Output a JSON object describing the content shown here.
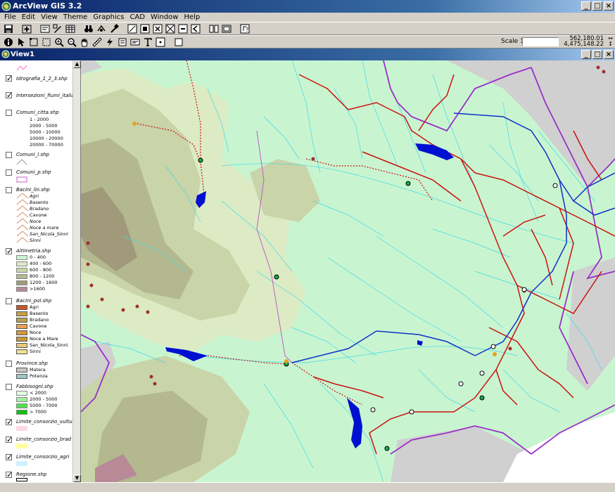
{
  "app": {
    "title": "ArcView GIS 3.2"
  },
  "window_buttons": [
    "_",
    "□",
    "×"
  ],
  "menus": [
    "File",
    "Edit",
    "View",
    "Theme",
    "Graphics",
    "CAD",
    "Window",
    "Help"
  ],
  "toolbar": {
    "scale_label": "Scale 1:",
    "scale_value": "",
    "coord_x": "562,180.01",
    "coord_y": "4,475,148.22"
  },
  "view": {
    "title": "View1"
  },
  "toc": {
    "layers": [
      {
        "name": "Idrografia_1_2_3.shp",
        "checked": true
      },
      {
        "name": "Intersezioni_fiumi_italia_.shp",
        "checked": true
      },
      {
        "name": "Comuni_citta.shp",
        "checked": false,
        "classes": [
          "1 - 2000",
          "2000 - 5000",
          "5000 - 10000",
          "10000 - 20000",
          "20000 - 70000"
        ]
      },
      {
        "name": "Comuni_l.shp",
        "checked": false
      },
      {
        "name": "Comuni_p.shp",
        "checked": false
      },
      {
        "name": "Bacini_lin.shp",
        "checked": false,
        "classes": [
          "Agri",
          "Basento",
          "Bradano",
          "Cavone",
          "Noce",
          "Noce a mare",
          "San_Nicola_Sinni",
          "Sinni"
        ]
      },
      {
        "name": "Altimetria.shp",
        "checked": true,
        "classes": [
          "0 - 400",
          "400 - 600",
          "600 - 800",
          "800 - 1200",
          "1200 - 1600",
          ">1600"
        ],
        "colors": [
          "#c8f5d0",
          "#dcebc4",
          "#c9d4a8",
          "#b3b88e",
          "#a09a7a",
          "#b88a98"
        ]
      },
      {
        "name": "Bacini_pol.shp",
        "checked": false,
        "classes": [
          "Agri",
          "Basento",
          "Bradano",
          "Cavone",
          "Noce",
          "Noce a Mare",
          "San_Nicola_Sinni",
          "Sinni"
        ],
        "colors": [
          "#c8562a",
          "#c8a040",
          "#b8a050",
          "#e8a050",
          "#d89838",
          "#c89838",
          "#e8c878",
          "#f0e090"
        ]
      },
      {
        "name": "Province.shp",
        "checked": false,
        "classes": [
          "Matera",
          "Potenza"
        ],
        "colors": [
          "#c8c8c8",
          "#a0c8c8"
        ]
      },
      {
        "name": "Fabbisogni.shp",
        "checked": false,
        "classes": [
          "< 2000",
          "2000 - 5000",
          "5000 - 7000",
          "> 7000"
        ],
        "colors": [
          "#e0ffe0",
          "#a0f0a0",
          "#50e050",
          "#10c010"
        ]
      },
      {
        "name": "Limite_consorzio_vulture",
        "checked": true,
        "color": "#ffd8e8"
      },
      {
        "name": "Limite_consorzio_brad",
        "checked": true,
        "color": "#ffffa0"
      },
      {
        "name": "Limite_consorzio_agri",
        "checked": true,
        "color": "#d0f0ff"
      },
      {
        "name": "Regione.shp",
        "checked": true
      }
    ]
  },
  "colors": {
    "lowland": "#c8f5d0",
    "hills": "#c9d4a8",
    "mountains": "#a09a7a",
    "peaks": "#b88a98",
    "outside": "#d0d0d0",
    "rivers": "#40d8e8",
    "basin_boundary": "#9a30c8",
    "canals": "#cc1010",
    "pipeline": "#1030c8",
    "lakes": "#0010d0"
  },
  "icons": [
    "globe-icon",
    "save-icon",
    "add-theme-icon",
    "identify-icon",
    "pointer-icon",
    "zoom-in-icon",
    "zoom-out-icon",
    "pan-icon",
    "text-icon"
  ]
}
